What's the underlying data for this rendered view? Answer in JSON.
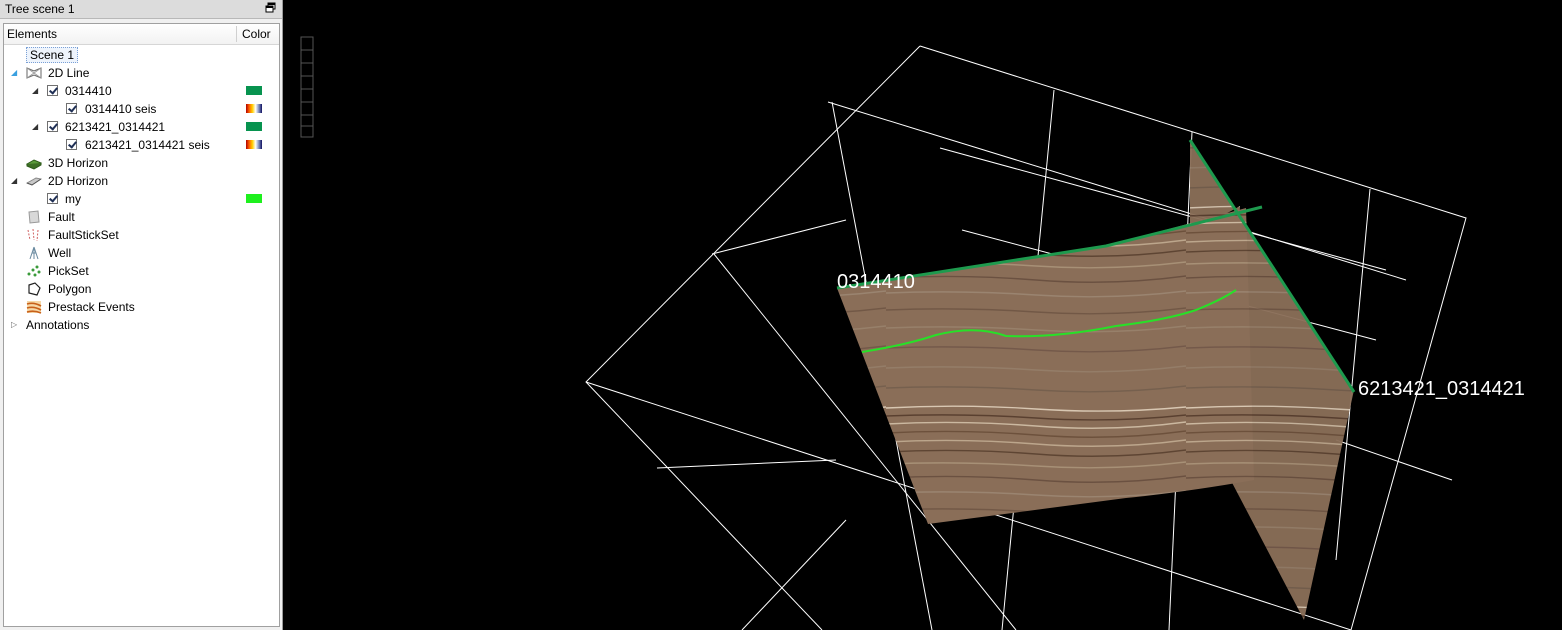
{
  "panel": {
    "title": "Tree scene 1",
    "header": {
      "elements": "Elements",
      "color": "Color"
    },
    "scene_label": "Scene 1",
    "items": [
      {
        "label": "2D Line"
      },
      {
        "label": "0314410",
        "color": "#07934f"
      },
      {
        "label": "0314410 seis"
      },
      {
        "label": "6213421_0314421",
        "color": "#07934f"
      },
      {
        "label": "6213421_0314421 seis"
      },
      {
        "label": "3D Horizon"
      },
      {
        "label": "2D Horizon"
      },
      {
        "label": "my",
        "color": "#1ef01e"
      },
      {
        "label": "Fault"
      },
      {
        "label": "FaultStickSet"
      },
      {
        "label": "Well"
      },
      {
        "label": "PickSet"
      },
      {
        "label": "Polygon"
      },
      {
        "label": "Prestack Events"
      },
      {
        "label": "Annotations"
      }
    ]
  },
  "viewer": {
    "line_a_label": "0314410",
    "line_b_label": "6213421_0314421",
    "line_color": "#1e9a4e",
    "horizon_color": "#28e028"
  }
}
